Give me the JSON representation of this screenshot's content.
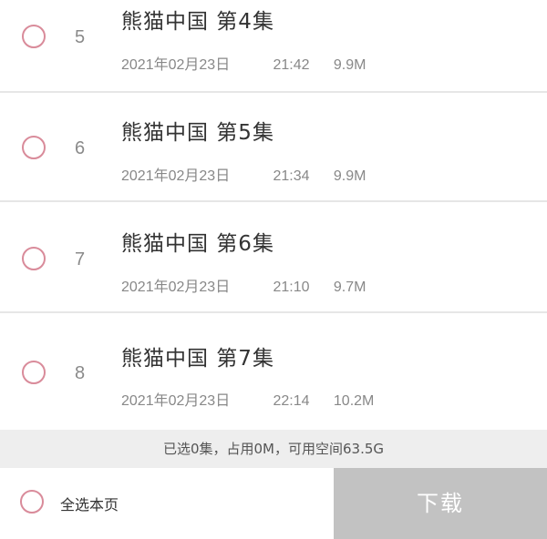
{
  "episodes": [
    {
      "index": "5",
      "title": "熊猫中国 第4集",
      "date": "2021年02月23日",
      "time": "21:42",
      "size": "9.9M"
    },
    {
      "index": "6",
      "title": "熊猫中国 第5集",
      "date": "2021年02月23日",
      "time": "21:34",
      "size": "9.9M"
    },
    {
      "index": "7",
      "title": "熊猫中国 第6集",
      "date": "2021年02月23日",
      "time": "21:10",
      "size": "9.7M"
    },
    {
      "index": "8",
      "title": "熊猫中国 第7集",
      "date": "2021年02月23日",
      "time": "22:14",
      "size": "10.2M"
    }
  ],
  "status": {
    "text": "已选0集，占用0M，可用空间63.5G"
  },
  "bottom": {
    "select_all_label": "全选本页",
    "download_label": "下载"
  },
  "colors": {
    "radio_border": "#d98b9a",
    "download_disabled_bg": "#c2c2c2",
    "status_bg": "#eeeeee"
  },
  "icons": {
    "row_selector": "radio-unchecked-icon",
    "select_all": "radio-unchecked-icon"
  }
}
